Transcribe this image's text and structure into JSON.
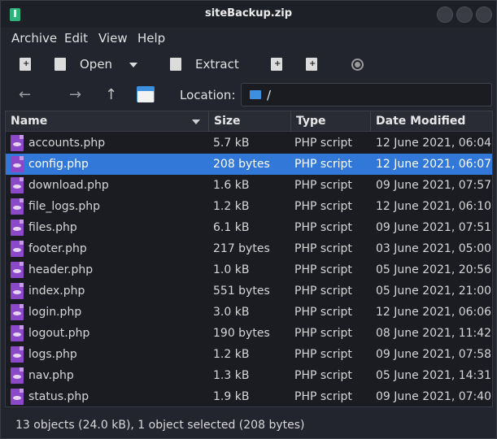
{
  "window": {
    "title": "siteBackup.zip"
  },
  "menu": [
    "Archive",
    "Edit",
    "View",
    "Help"
  ],
  "toolbar": {
    "open_label": "Open",
    "extract_label": "Extract"
  },
  "location": {
    "label": "Location:",
    "path": "/"
  },
  "columns": [
    "Name",
    "Size",
    "Type",
    "Date Modified"
  ],
  "files": [
    {
      "name": "accounts.php",
      "size": "5.7 kB",
      "type": "PHP script",
      "date": "12 June 2021, 06:04",
      "selected": false
    },
    {
      "name": "config.php",
      "size": "208 bytes",
      "type": "PHP script",
      "date": "12 June 2021, 06:07",
      "selected": true
    },
    {
      "name": "download.php",
      "size": "1.6 kB",
      "type": "PHP script",
      "date": "09 June 2021, 07:57",
      "selected": false
    },
    {
      "name": "file_logs.php",
      "size": "1.2 kB",
      "type": "PHP script",
      "date": "12 June 2021, 06:10",
      "selected": false
    },
    {
      "name": "files.php",
      "size": "6.1 kB",
      "type": "PHP script",
      "date": "09 June 2021, 07:51",
      "selected": false
    },
    {
      "name": "footer.php",
      "size": "217 bytes",
      "type": "PHP script",
      "date": "03 June 2021, 05:00",
      "selected": false
    },
    {
      "name": "header.php",
      "size": "1.0 kB",
      "type": "PHP script",
      "date": "05 June 2021, 20:56",
      "selected": false
    },
    {
      "name": "index.php",
      "size": "551 bytes",
      "type": "PHP script",
      "date": "05 June 2021, 21:00",
      "selected": false
    },
    {
      "name": "login.php",
      "size": "3.0 kB",
      "type": "PHP script",
      "date": "12 June 2021, 06:06",
      "selected": false
    },
    {
      "name": "logout.php",
      "size": "190 bytes",
      "type": "PHP script",
      "date": "08 June 2021, 11:42",
      "selected": false
    },
    {
      "name": "logs.php",
      "size": "1.2 kB",
      "type": "PHP script",
      "date": "09 June 2021, 07:58",
      "selected": false
    },
    {
      "name": "nav.php",
      "size": "1.3 kB",
      "type": "PHP script",
      "date": "05 June 2021, 14:31",
      "selected": false
    },
    {
      "name": "status.php",
      "size": "1.9 kB",
      "type": "PHP script",
      "date": "09 June 2021, 07:40",
      "selected": false
    }
  ],
  "status": "13 objects (24.0 kB), 1 object selected (208 bytes)",
  "icons": {
    "app": "archive-icon",
    "new": "new-archive-icon",
    "open": "open-archive-icon",
    "extract": "extract-icon",
    "add_files": "add-files-icon",
    "add_folder": "add-folder-icon",
    "stop": "stop-icon",
    "back": "back-arrow-icon",
    "forward": "forward-arrow-icon",
    "up": "up-arrow-icon",
    "home": "home-folder-icon",
    "file": "php-file-icon"
  },
  "colors": {
    "selection": "#3178d8",
    "php_icon": "#8b48c9",
    "folder": "#3d8fe0"
  }
}
